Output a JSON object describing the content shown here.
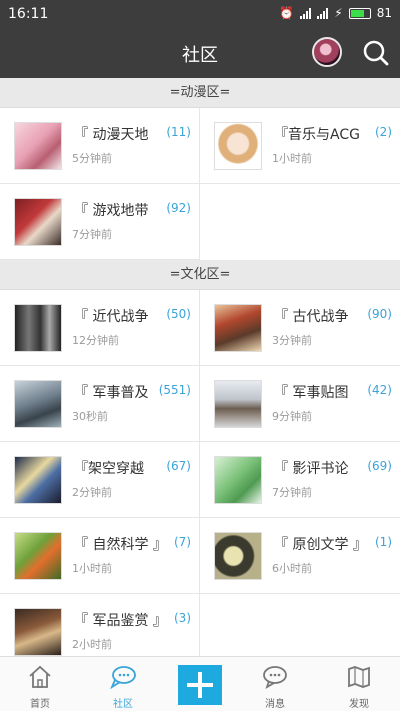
{
  "status": {
    "time": "16:11",
    "battery": "81"
  },
  "header": {
    "title": "社区"
  },
  "sections": [
    {
      "title": "=动漫区=",
      "items": [
        {
          "name": "『 动漫天地",
          "count": "(11)",
          "time": "5分钟前",
          "thumb": "anime-pink"
        },
        {
          "name": "『音乐与ACG",
          "count": "(2)",
          "time": "1小时前",
          "thumb": "anime-girl"
        },
        {
          "name": "『 游戏地带",
          "count": "(92)",
          "time": "7分钟前",
          "thumb": "game-red"
        }
      ]
    },
    {
      "title": "=文化区=",
      "items": [
        {
          "name": "『 近代战争",
          "count": "(50)",
          "time": "12分钟前",
          "thumb": "war-bw"
        },
        {
          "name": "『 古代战争",
          "count": "(90)",
          "time": "3分钟前",
          "thumb": "ancient-war"
        },
        {
          "name": "『 军事普及",
          "count": "(551)",
          "time": "30秒前",
          "thumb": "ship"
        },
        {
          "name": "『 军事贴图",
          "count": "(42)",
          "time": "9分钟前",
          "thumb": "statue"
        },
        {
          "name": "『架空穿越",
          "count": "(67)",
          "time": "2分钟前",
          "thumb": "fiction"
        },
        {
          "name": "『 影评书论",
          "count": "(69)",
          "time": "7分钟前",
          "thumb": "green-film"
        },
        {
          "name": "『 自然科学 』",
          "count": "(7)",
          "time": "1小时前",
          "thumb": "nature"
        },
        {
          "name": "『 原创文学 』",
          "count": "(1)",
          "time": "6小时前",
          "thumb": "literature"
        },
        {
          "name": "『 军品鉴赏 』",
          "count": "(3)",
          "time": "2小时前",
          "thumb": "military-item"
        }
      ]
    }
  ],
  "tabs": [
    {
      "label": "首页",
      "icon": "home-icon"
    },
    {
      "label": "社区",
      "icon": "community-chat-icon"
    },
    {
      "label": "",
      "icon": "add-icon"
    },
    {
      "label": "消息",
      "icon": "message-icon"
    },
    {
      "label": "发现",
      "icon": "discover-map-icon"
    }
  ],
  "colors": {
    "accent": "#3aa3d8",
    "header": "#3d3d3d",
    "add_button": "#1eaade"
  }
}
